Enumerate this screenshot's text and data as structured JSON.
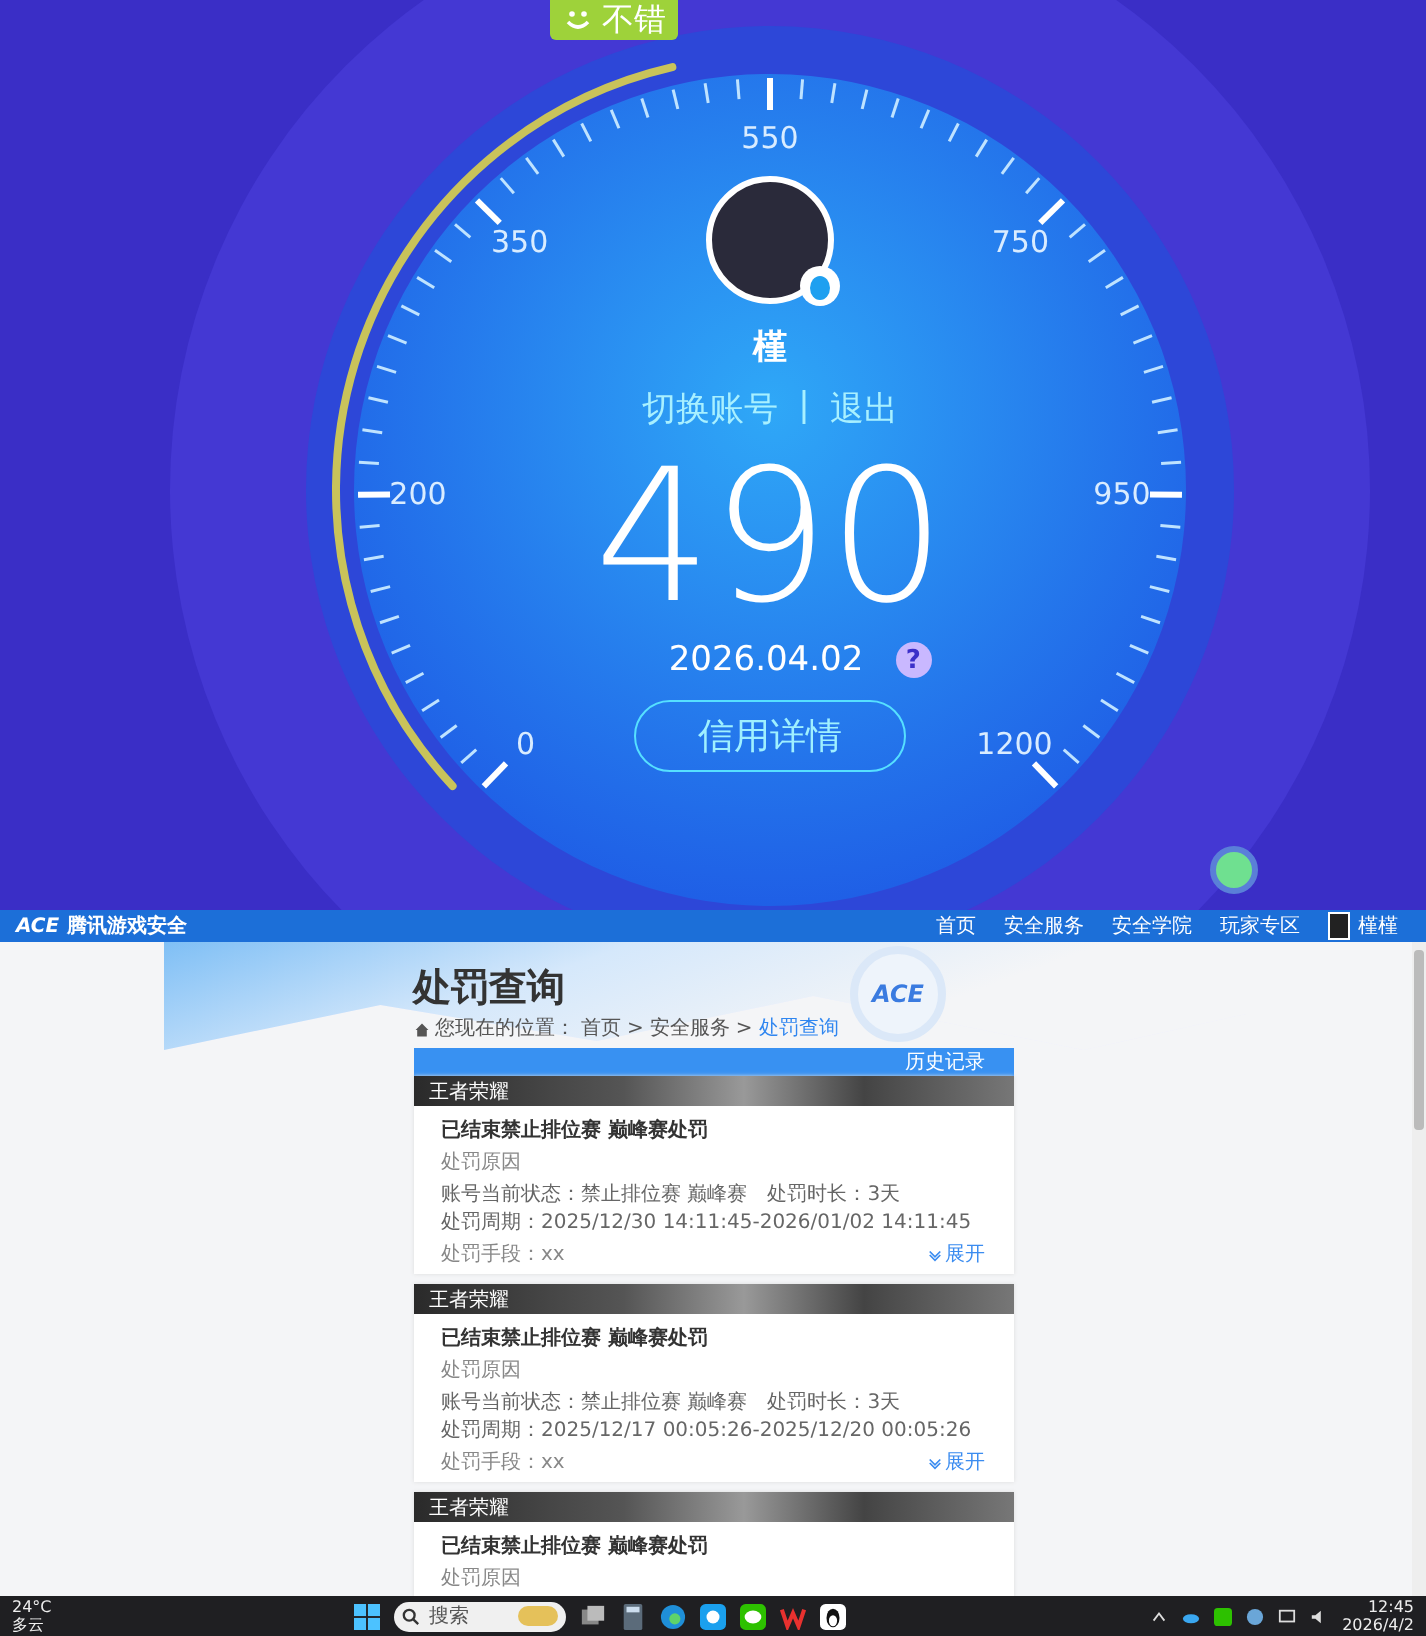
{
  "score_screen": {
    "badge": {
      "text": "不错"
    },
    "scale_labels": [
      "0",
      "200",
      "350",
      "550",
      "750",
      "950",
      "1200"
    ],
    "user": {
      "name": "槿"
    },
    "account_links": [
      "切换账号",
      "退出"
    ],
    "link_separator": "|",
    "score": "490",
    "date": "2026.04.02",
    "help": "?",
    "details_button": "信用详情"
  },
  "browser_page": {
    "nav": {
      "logo_mark": "ACE",
      "site_name": "腾讯游戏安全",
      "links": [
        "首页",
        "安全服务",
        "安全学院",
        "玩家专区"
      ],
      "user_name": "槿槿"
    },
    "page_title": "处罚查询",
    "emblem": "ACE",
    "breadcrumb": {
      "prefix": "您现在的位置：",
      "separator": ">",
      "items": [
        {
          "label": "首页",
          "selected": false
        },
        {
          "label": "安全服务",
          "selected": false
        },
        {
          "label": "处罚查询",
          "selected": true
        }
      ]
    },
    "toolbar_link": "历史记录",
    "records": [
      {
        "game": "王者荣耀",
        "title": "已结束禁止排位赛 巅峰赛处罚",
        "reason_label": "处罚原因",
        "status": "账号当前状态：禁止排位赛 巅峰赛",
        "duration": "处罚时长：3天",
        "period": "处罚周期：2025/12/30 14:11:45-2026/01/02 14:11:45",
        "method": "处罚手段：xx",
        "expand": "展开"
      },
      {
        "game": "王者荣耀",
        "title": "已结束禁止排位赛 巅峰赛处罚",
        "reason_label": "处罚原因",
        "status": "账号当前状态：禁止排位赛 巅峰赛",
        "duration": "处罚时长：3天",
        "period": "处罚周期：2025/12/17 00:05:26-2025/12/20 00:05:26",
        "method": "处罚手段：xx",
        "expand": "展开"
      },
      {
        "game": "王者荣耀",
        "title": "已结束禁止排位赛 巅峰赛处罚",
        "reason_label": "处罚原因"
      }
    ]
  },
  "taskbar": {
    "weather": {
      "temp": "24°C",
      "text": "多云"
    },
    "search_placeholder": "搜索",
    "time": "12:45",
    "date": "2026/4/2"
  }
}
